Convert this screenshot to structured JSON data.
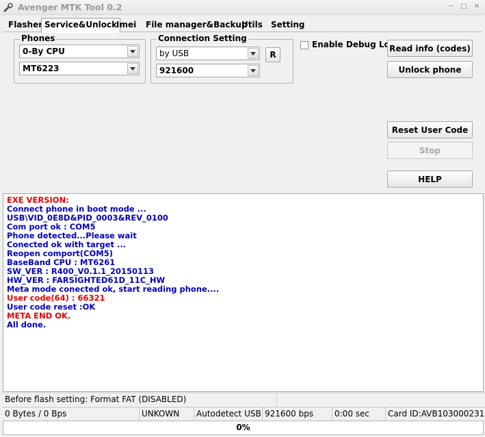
{
  "window": {
    "title": "Avenger MTK Tool 0.2",
    "icon": "wrench-icon"
  },
  "tabs": [
    {
      "label": "Flasher"
    },
    {
      "label": "Service&Unlock"
    },
    {
      "label": "Imei"
    },
    {
      "label": "File manager&Backup"
    },
    {
      "label": "Utils"
    },
    {
      "label": "Setting"
    }
  ],
  "active_tab": "Service&Unlock",
  "phones": {
    "title": "Phones",
    "cpu_value": "0-By CPU",
    "model_value": "MT6223"
  },
  "connection": {
    "title": "Connection Setting",
    "port_value": "by USB",
    "baud_value": "921600",
    "refresh_label": "R"
  },
  "debug": {
    "label": "Enable Debug Log",
    "checked": false
  },
  "buttons": {
    "read_info": "Read info (codes)",
    "unlock_phone": "Unlock phone",
    "reset_user_code": "Reset User Code",
    "stop": "Stop",
    "help": "HELP"
  },
  "colors": {
    "log_red": "#e60000",
    "log_blue": "#0000c0"
  },
  "log": [
    {
      "text": "EXE VERSION:",
      "color": "red"
    },
    {
      "text": "Connect phone in boot mode ...",
      "color": "blue"
    },
    {
      "text": "USB\\VID_0E8D&PID_0003&REV_0100",
      "color": "blue"
    },
    {
      "text": "Com port ok : COM5",
      "color": "blue"
    },
    {
      "text": "Phone detected...Please wait",
      "color": "blue"
    },
    {
      "text": "Conected ok with target ...",
      "color": "blue"
    },
    {
      "text": "Reopen comport(COM5)",
      "color": "blue"
    },
    {
      "text": "BaseBand CPU : MT6261",
      "color": "blue"
    },
    {
      "text": "SW_VER : R400_V0.1.1_20150113",
      "color": "blue"
    },
    {
      "text": "HW_VER : FARSIGHTED61D_11C_HW",
      "color": "blue"
    },
    {
      "text": "Meta mode conected ok, start reading phone....",
      "color": "blue"
    },
    {
      "text": "User code(64) : 66321",
      "color": "red"
    },
    {
      "text": "User code reset :OK",
      "color": "blue"
    },
    {
      "text": "META END OK.",
      "color": "red"
    },
    {
      "text": "All done.",
      "color": "blue"
    }
  ],
  "status_top": {
    "flash_setting": "Before flash setting: Format FAT (DISABLED)",
    "extra": ""
  },
  "status_bottom": {
    "transfer": "0 Bytes / 0 Bps",
    "device": "UNKOWN",
    "mode": "Autodetect USB",
    "speed": "921600 bps",
    "time": "0:00 sec",
    "card_id": "Card ID:AVB103000231"
  },
  "progress": {
    "label": "0%",
    "value": 0
  }
}
